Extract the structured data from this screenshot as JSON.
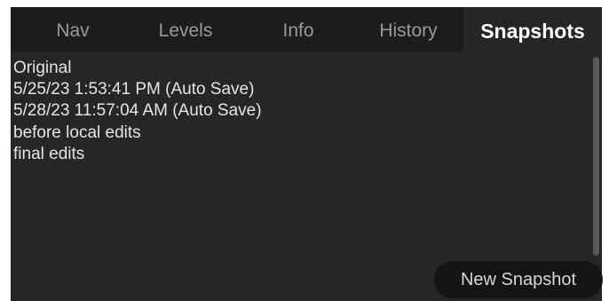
{
  "tabs": {
    "nav": "Nav",
    "levels": "Levels",
    "info": "Info",
    "history": "History",
    "snapshots": "Snapshots",
    "active": "Snapshots"
  },
  "snapshots": [
    "Original",
    "5/25/23 1:53:41 PM (Auto Save)",
    "5/28/23 11:57:04 AM (Auto Save)",
    "before local edits",
    "final edits"
  ],
  "actions": {
    "new_snapshot_label": "New Snapshot"
  },
  "colors": {
    "panel_background": "#262626",
    "tab_bar_background": "#1c1c1c",
    "active_tab_text": "#ffffff",
    "inactive_tab_text": "#9a9a9a",
    "button_background": "#141414"
  }
}
